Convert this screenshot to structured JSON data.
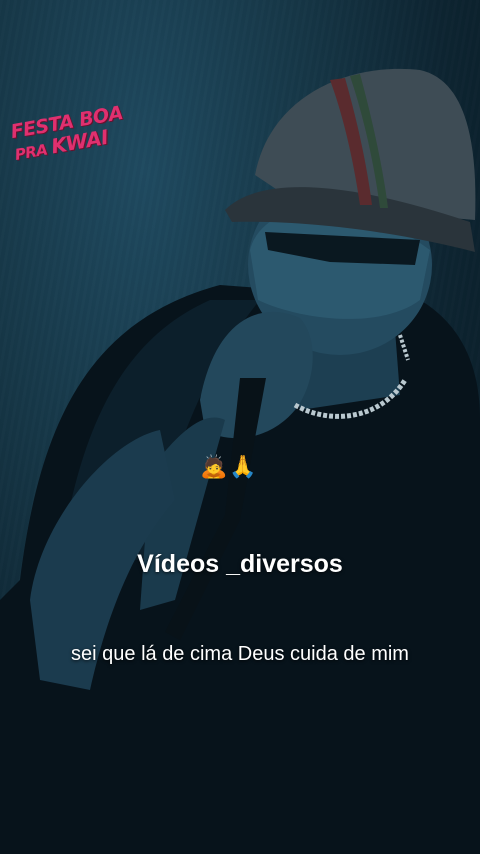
{
  "video": {
    "logo_line1": "FESTA BOA",
    "logo_line2_small": "PRA",
    "logo_line2_big": "KWAI",
    "emojis": "🙇🙏",
    "watermark": "Vídeos _diversos",
    "subtitle": "sei que lá de cima Deus cuida de mim"
  },
  "colors": {
    "logo": "#e0306f",
    "background": "#163747"
  }
}
